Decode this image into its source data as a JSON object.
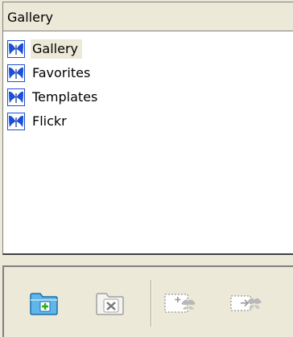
{
  "panel": {
    "title": "Gallery"
  },
  "tree": {
    "items": [
      {
        "label": "Gallery",
        "selected": true
      },
      {
        "label": "Favorites",
        "selected": false
      },
      {
        "label": "Templates",
        "selected": false
      },
      {
        "label": "Flickr",
        "selected": false
      }
    ],
    "item_icon": "butterfly-icon"
  },
  "toolbar": {
    "buttons": [
      {
        "name": "add-folder",
        "icon": "folder-add-icon",
        "enabled": true
      },
      {
        "name": "delete-folder",
        "icon": "folder-delete-icon",
        "enabled": false
      },
      {
        "name": "add-to-gallery",
        "icon": "add-to-gallery-icon",
        "enabled": false
      },
      {
        "name": "add-to-favorites",
        "icon": "add-to-favorites-icon",
        "enabled": false
      }
    ]
  },
  "colors": {
    "window_bg": "#ece9d8",
    "list_bg": "#ffffff",
    "icon_blue": "#1b4fd6",
    "folder_blue": "#5fb6e8",
    "plus_green": "#27b01c"
  }
}
